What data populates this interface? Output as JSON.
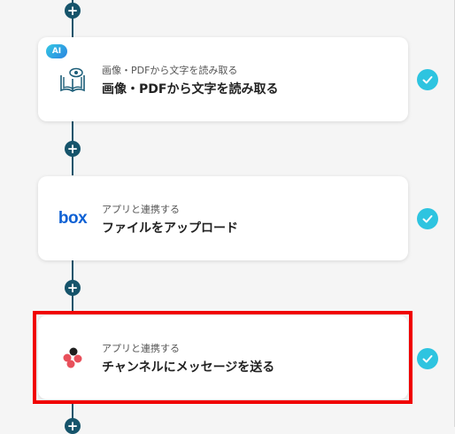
{
  "steps": [
    {
      "badge": "AI",
      "subtitle": "画像・PDFから文字を読み取る",
      "title": "画像・PDFから文字を読み取る",
      "icon": "book-eye-icon"
    },
    {
      "logo_text": "box",
      "subtitle": "アプリと連携する",
      "title": "ファイルをアップロード",
      "icon": "box-logo"
    },
    {
      "subtitle": "アプリと連携する",
      "title": "チャンネルにメッセージを送る",
      "icon": "slack-like-logo"
    }
  ],
  "add_label": "+",
  "colors": {
    "connector": "#16546b",
    "check": "#2ec4e0",
    "highlight": "#f00000"
  }
}
